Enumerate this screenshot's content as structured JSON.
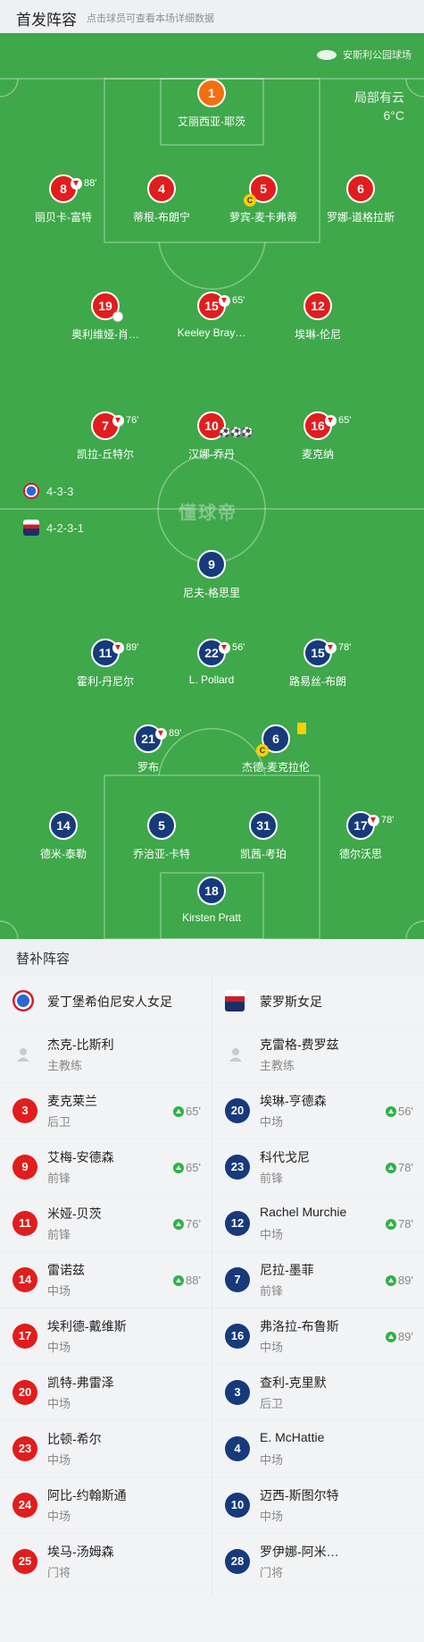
{
  "header": {
    "title": "首发阵容",
    "hint": "点击球员可查看本场详细数据"
  },
  "pitch": {
    "venue": "安斯利公园球场",
    "weather": {
      "condition": "局部有云",
      "temp": "6°C"
    },
    "watermark": "懂球帝",
    "home_formation": "4-3-3",
    "away_formation": "4-2-3-1"
  },
  "home_lineup": [
    {
      "num": "1",
      "name": "艾丽西亚-耶茨",
      "gk": true
    },
    {
      "num": "8",
      "name": "丽贝卡-富特",
      "sub_out": "88'"
    },
    {
      "num": "4",
      "name": "蒂根-布朗宁"
    },
    {
      "num": "5",
      "name": "萝宾-麦卡弗蒂",
      "captain": "C"
    },
    {
      "num": "6",
      "name": "罗娜-道格拉斯"
    },
    {
      "num": "19",
      "name": "奥利维娅-肖…"
    },
    {
      "num": "15",
      "name": "Keeley Bray…",
      "sub_out": "65'"
    },
    {
      "num": "12",
      "name": "埃琳-伦尼"
    },
    {
      "num": "7",
      "name": "凯拉-丘特尔",
      "sub_out": "76'"
    },
    {
      "num": "10",
      "name": "汉娜-乔丹",
      "goals": "⚽⚽⚽"
    },
    {
      "num": "16",
      "name": "麦克纳",
      "sub_out": "65'"
    }
  ],
  "away_lineup": [
    {
      "num": "9",
      "name": "尼夫-格思里"
    },
    {
      "num": "11",
      "name": "霍利-丹尼尔",
      "sub_out": "89'"
    },
    {
      "num": "22",
      "name": "L. Pollard",
      "sub_out": "56'"
    },
    {
      "num": "15",
      "name": "路易丝-布朗",
      "sub_out": "78'"
    },
    {
      "num": "21",
      "name": "罗布",
      "sub_out": "89'"
    },
    {
      "num": "6",
      "name": "杰德-麦克拉伦",
      "captain": "C"
    },
    {
      "num": "14",
      "name": "德米-泰勒"
    },
    {
      "num": "5",
      "name": "乔治亚-卡特"
    },
    {
      "num": "31",
      "name": "凯茜-考珀"
    },
    {
      "num": "17",
      "name": "德尔沃思",
      "sub_out": "78'"
    },
    {
      "num": "18",
      "name": "Kirsten Pratt"
    }
  ],
  "subs": {
    "title": "替补阵容",
    "home": {
      "team": "爱丁堡希伯尼安人女足",
      "coach": {
        "name": "杰克-比斯利",
        "role": "主教练"
      },
      "players": [
        {
          "num": "3",
          "name": "麦克莱兰",
          "pos": "后卫",
          "in": "65'"
        },
        {
          "num": "9",
          "name": "艾梅-安德森",
          "pos": "前锋",
          "in": "65'"
        },
        {
          "num": "11",
          "name": "米娅-贝茨",
          "pos": "前锋",
          "in": "76'"
        },
        {
          "num": "14",
          "name": "雷诺兹",
          "pos": "中场",
          "in": "88'"
        },
        {
          "num": "17",
          "name": "埃利德-戴维斯",
          "pos": "中场"
        },
        {
          "num": "20",
          "name": "凯特-弗雷泽",
          "pos": "中场"
        },
        {
          "num": "23",
          "name": "比顿-希尔",
          "pos": "中场"
        },
        {
          "num": "24",
          "name": "阿比-约翰斯通",
          "pos": "中场"
        },
        {
          "num": "25",
          "name": "埃马-汤姆森",
          "pos": "门将"
        }
      ]
    },
    "away": {
      "team": "蒙罗斯女足",
      "coach": {
        "name": "克雷格-费罗兹",
        "role": "主教练"
      },
      "players": [
        {
          "num": "20",
          "name": "埃琳-亨德森",
          "pos": "中场",
          "in": "56'"
        },
        {
          "num": "23",
          "name": "科代戈尼",
          "pos": "前锋",
          "in": "78'"
        },
        {
          "num": "12",
          "name": "Rachel Murchie",
          "pos": "中场",
          "in": "78'"
        },
        {
          "num": "7",
          "name": "尼拉-墨菲",
          "pos": "前锋",
          "in": "89'"
        },
        {
          "num": "16",
          "name": "弗洛拉-布鲁斯",
          "pos": "中场",
          "in": "89'"
        },
        {
          "num": "3",
          "name": "查利-克里默",
          "pos": "后卫"
        },
        {
          "num": "4",
          "name": "E. McHattie",
          "pos": "中场"
        },
        {
          "num": "10",
          "name": "迈西-斯图尔特",
          "pos": "中场"
        },
        {
          "num": "28",
          "name": "罗伊娜-阿米…",
          "pos": "门将"
        }
      ]
    }
  },
  "colors": {
    "pitch": "#3fa84a",
    "home": "#e11d1d",
    "away": "#173a7a",
    "gk": "#f46e12"
  }
}
